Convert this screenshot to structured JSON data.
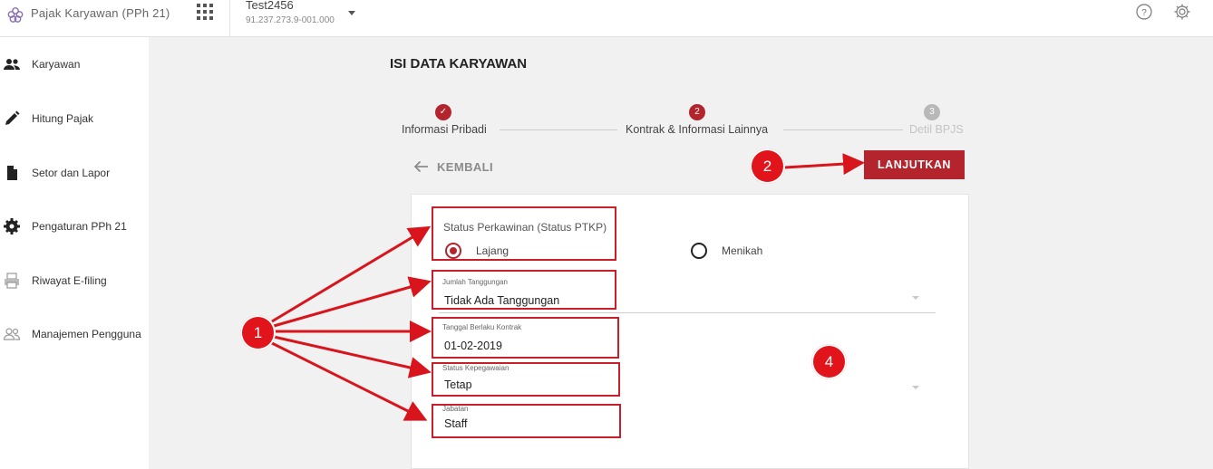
{
  "header": {
    "app_name": "Pajak Karyawan (PPh 21)",
    "company_name": "Test2456",
    "company_npwp": "91.237.273.9-001.000"
  },
  "sidebar": {
    "items": [
      {
        "label": "Karyawan",
        "icon": "people-icon"
      },
      {
        "label": "Hitung Pajak",
        "icon": "pencil-icon"
      },
      {
        "label": "Setor dan Lapor",
        "icon": "document-icon"
      },
      {
        "label": "Pengaturan PPh 21",
        "icon": "gear-icon"
      },
      {
        "label": "Riwayat E-filing",
        "icon": "printer-icon"
      },
      {
        "label": "Manajemen Pengguna",
        "icon": "users-icon"
      }
    ]
  },
  "main": {
    "title": "ISI DATA KARYAWAN",
    "steps": [
      {
        "label": "Informasi Pribadi",
        "marker": "✓",
        "state": "done"
      },
      {
        "label": "Kontrak & Informasi Lainnya",
        "marker": "2",
        "state": "active"
      },
      {
        "label": "Detil BPJS",
        "marker": "3",
        "state": "pending"
      }
    ],
    "back_label": "KEMBALI",
    "next_label": "LANJUTKAN"
  },
  "form": {
    "marital_status_label": "Status Perkawinan (Status PTKP)",
    "marital_options": [
      "Lajang",
      "Menikah"
    ],
    "marital_selected": "Lajang",
    "dependents_label": "Jumlah Tanggungan",
    "dependents_value": "Tidak Ada Tanggungan",
    "contract_date_label": "Tanggal Berlaku Kontrak",
    "contract_date_value": "01-02-2019",
    "employment_status_label": "Status Kepegawaian",
    "employment_status_value": "Tetap",
    "position_label": "Jabatan",
    "position_value": "Staff"
  },
  "annotations": {
    "markers": [
      "1",
      "2",
      "4"
    ]
  },
  "colors": {
    "accent": "#b3242d",
    "annotation_red": "#e0141a",
    "step_done": "#b3242d",
    "step_pending": "#b8b8b8"
  }
}
